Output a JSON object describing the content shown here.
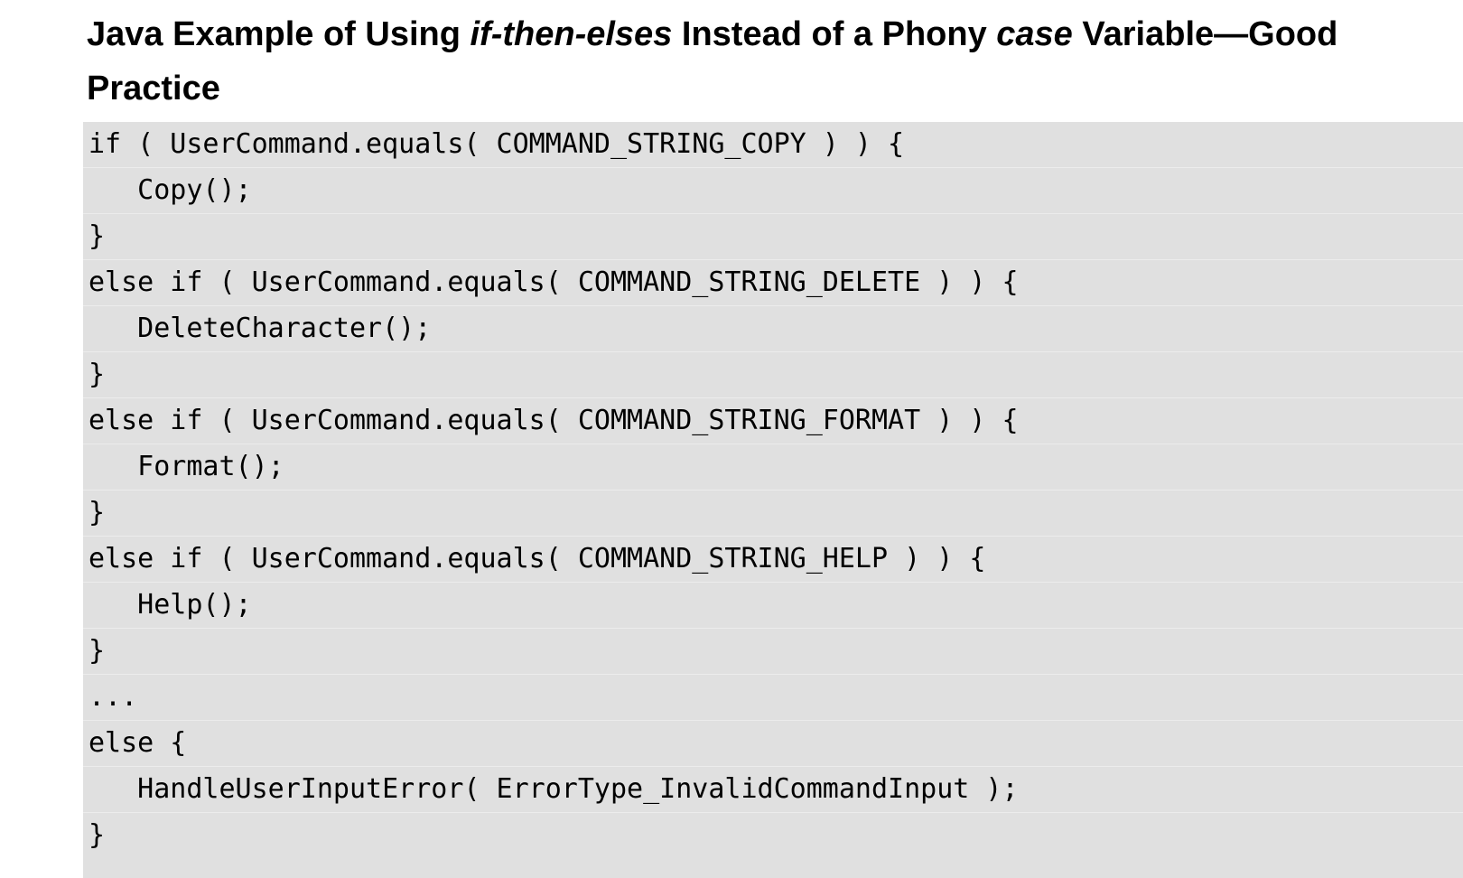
{
  "heading": {
    "part1": "Java Example of Using ",
    "emph1": "if-then-elses",
    "part2": " Instead of a Phony ",
    "emph2": "case",
    "part3": " Variable—Good Practice"
  },
  "code_lines": [
    "if ( UserCommand.equals( COMMAND_STRING_COPY ) ) {",
    "   Copy();",
    "}",
    "else if ( UserCommand.equals( COMMAND_STRING_DELETE ) ) {",
    "   DeleteCharacter();",
    "}",
    "else if ( UserCommand.equals( COMMAND_STRING_FORMAT ) ) {",
    "   Format();",
    "}",
    "else if ( UserCommand.equals( COMMAND_STRING_HELP ) ) {",
    "   Help();",
    "}",
    "...",
    "else {",
    "   HandleUserInputError( ErrorType_InvalidCommandInput );",
    "}"
  ]
}
